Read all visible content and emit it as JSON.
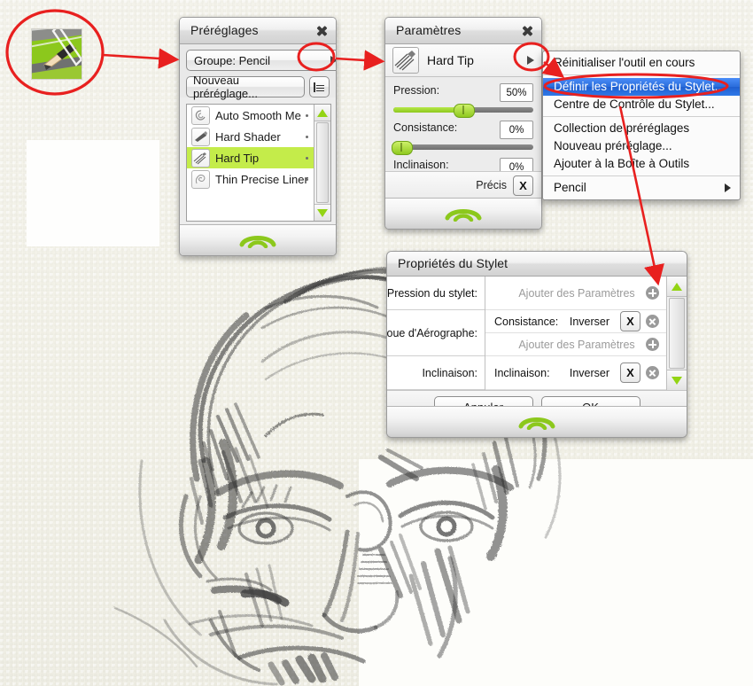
{
  "presets_panel": {
    "title": "Préréglages",
    "close_icon": "close-icon",
    "group_button": "Groupe: Pencil",
    "group_arrow_icon": "triangle-right-icon",
    "new_preset_button": "Nouveau préréglage...",
    "list_menu_icon": "list-menu-icon",
    "items": [
      {
        "label": "Auto Smooth Me",
        "selected": false,
        "thumb": "swirl-brush-thumb"
      },
      {
        "label": "Hard Shader",
        "selected": false,
        "thumb": "shader-brush-thumb"
      },
      {
        "label": "Hard Tip",
        "selected": true,
        "thumb": "hard-tip-brush-thumb"
      },
      {
        "label": "Thin Precise Liner",
        "selected": false,
        "thumb": "liner-brush-thumb"
      }
    ],
    "scroll_up_icon": "triangle-up-icon",
    "scroll_down_icon": "triangle-down-icon",
    "grip_icon": "grip-handle-icon",
    "selection_color": "#c4ec4a"
  },
  "settings_panel": {
    "title": "Paramètres",
    "close_icon": "close-icon",
    "tool_name": "Hard Tip",
    "tool_thumb": "hard-tip-brush-thumb",
    "tool_arrow_icon": "triangle-right-icon",
    "sliders": [
      {
        "label": "Pression:",
        "value": "50%",
        "percent": 50
      },
      {
        "label": "Consistance:",
        "value": "0%",
        "percent": 0
      },
      {
        "label": "Inclinaison:",
        "value": "0%",
        "percent": 0
      }
    ],
    "precision_label": "Précis",
    "precision_button": "X",
    "grip_icon": "grip-handle-icon",
    "slider_color": "#8fc91f"
  },
  "context_menu": {
    "items": [
      {
        "label": "Réinitialiser l'outil en cours",
        "highlighted": false,
        "submenu": false
      },
      {
        "separator": true
      },
      {
        "label": "Définir les Propriétés du Stylet...",
        "highlighted": true,
        "submenu": false
      },
      {
        "label": "Centre de Contrôle du Stylet...",
        "highlighted": false,
        "submenu": false
      },
      {
        "separator": true
      },
      {
        "label": "Collection de préréglages",
        "highlighted": false,
        "submenu": false
      },
      {
        "label": "Nouveau préréglage...",
        "highlighted": false,
        "submenu": false
      },
      {
        "label": "Ajouter à la Boîte à Outils",
        "highlighted": false,
        "submenu": false
      },
      {
        "separator": true
      },
      {
        "label": "Pencil",
        "highlighted": false,
        "submenu": true
      }
    ],
    "highlight_color": "#2a6ddb",
    "submenu_arrow_icon": "triangle-right-icon"
  },
  "stylus_dialog": {
    "title": "Propriétés du Stylet",
    "rows": [
      {
        "left": "Pression du stylet:",
        "cells": [
          {
            "text": "Ajouter des Paramètres",
            "type": "add",
            "icon": "plus-circle-icon"
          }
        ]
      },
      {
        "left": "oue d'Aérographe:",
        "cells": [
          {
            "text": "Consistance:",
            "action": "Inverser",
            "button": "X",
            "type": "mapped",
            "icon": "remove-circle-icon"
          },
          {
            "text": "Ajouter des Paramètres",
            "type": "add",
            "icon": "plus-circle-icon"
          }
        ]
      },
      {
        "left": "Inclinaison:",
        "cells": [
          {
            "text": "Inclinaison:",
            "action": "Inverser",
            "button": "X",
            "type": "mapped",
            "icon": "remove-circle-icon"
          }
        ]
      }
    ],
    "scroll_up_icon": "triangle-up-icon",
    "scroll_down_icon": "triangle-down-icon",
    "cancel_button": "Annuler",
    "ok_button": "OK",
    "grip_icon": "grip-handle-icon"
  },
  "annotations": {
    "inset_label": "pencil-toolbox-inset",
    "circle_color": "#e8201f",
    "arrow_color": "#e8201f"
  },
  "canvas": {
    "artwork": "pencil-portrait-sketch",
    "paper_color": "#f4f3e9"
  }
}
